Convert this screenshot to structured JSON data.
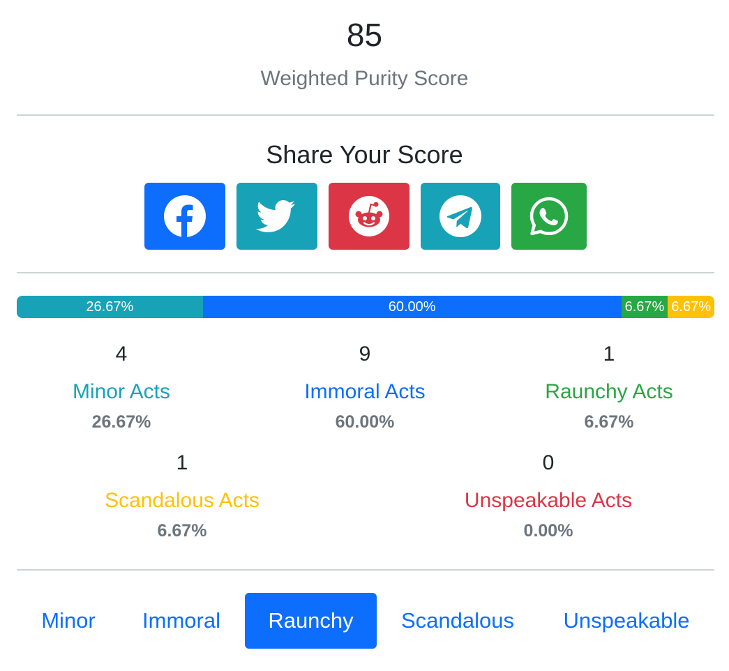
{
  "score": {
    "value": "85",
    "label": "Weighted Purity Score"
  },
  "share": {
    "title": "Share Your Score",
    "buttons": [
      {
        "icon": "facebook-icon",
        "color": "#0d6efd"
      },
      {
        "icon": "twitter-icon",
        "color": "#17a2b8"
      },
      {
        "icon": "reddit-icon",
        "color": "#dc3545"
      },
      {
        "icon": "telegram-icon",
        "color": "#17a2b8"
      },
      {
        "icon": "whatsapp-icon",
        "color": "#28a745"
      }
    ]
  },
  "progress": {
    "segments": [
      {
        "label": "26.67%",
        "percent": 26.67,
        "color": "#17a2b8"
      },
      {
        "label": "60.00%",
        "percent": 60.0,
        "color": "#0d6efd"
      },
      {
        "label": "6.67%",
        "percent": 6.67,
        "color": "#28a745"
      },
      {
        "label": "6.67%",
        "percent": 6.67,
        "color": "#ffc107"
      }
    ]
  },
  "stats": [
    {
      "count": "4",
      "label": "Minor Acts",
      "pct": "26.67%",
      "color": "#17a2b8"
    },
    {
      "count": "9",
      "label": "Immoral Acts",
      "pct": "60.00%",
      "color": "#0d6efd"
    },
    {
      "count": "1",
      "label": "Raunchy Acts",
      "pct": "6.67%",
      "color": "#28a745"
    },
    {
      "count": "1",
      "label": "Scandalous Acts",
      "pct": "6.67%",
      "color": "#ffc107"
    },
    {
      "count": "0",
      "label": "Unspeakable Acts",
      "pct": "0.00%",
      "color": "#dc3545"
    }
  ],
  "tabs": [
    {
      "label": "Minor",
      "active": false
    },
    {
      "label": "Immoral",
      "active": false
    },
    {
      "label": "Raunchy",
      "active": true
    },
    {
      "label": "Scandalous",
      "active": false
    },
    {
      "label": "Unspeakable",
      "active": false
    }
  ]
}
